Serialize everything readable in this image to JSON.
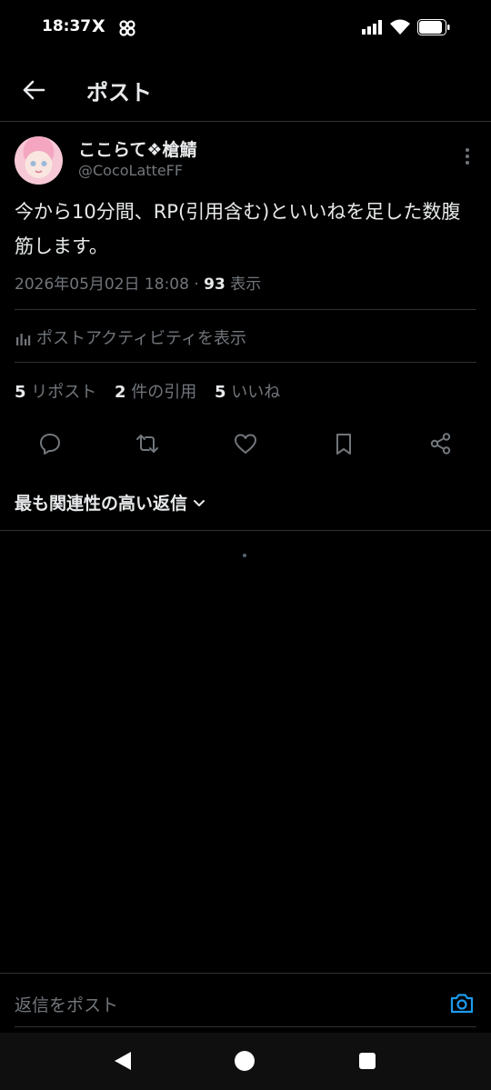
{
  "status_bar": {
    "time": "18:37",
    "x_icon": "X"
  },
  "header": {
    "title": "ポスト"
  },
  "post": {
    "display_name": "ここらて❖槍鯖",
    "handle": "@CocoLatteFF",
    "text": "今から10分間、RP(引用含む)といいねを足した数腹筋します。",
    "datetime": "2026年05月02日 18:08",
    "separator": "·",
    "views_count": "93",
    "views_label": "表示"
  },
  "activity": {
    "label": "ポストアクティビティを表示"
  },
  "stats": [
    {
      "num": "5",
      "label": "リポスト"
    },
    {
      "num": "2",
      "label": "件の引用"
    },
    {
      "num": "5",
      "label": "いいね"
    }
  ],
  "sort": {
    "label": "最も関連性の高い返信"
  },
  "reply": {
    "placeholder": "返信をポスト"
  },
  "colors": {
    "accent": "#1d9bf0",
    "background": "#000000",
    "muted": "#71767b",
    "border": "#2f3336"
  }
}
